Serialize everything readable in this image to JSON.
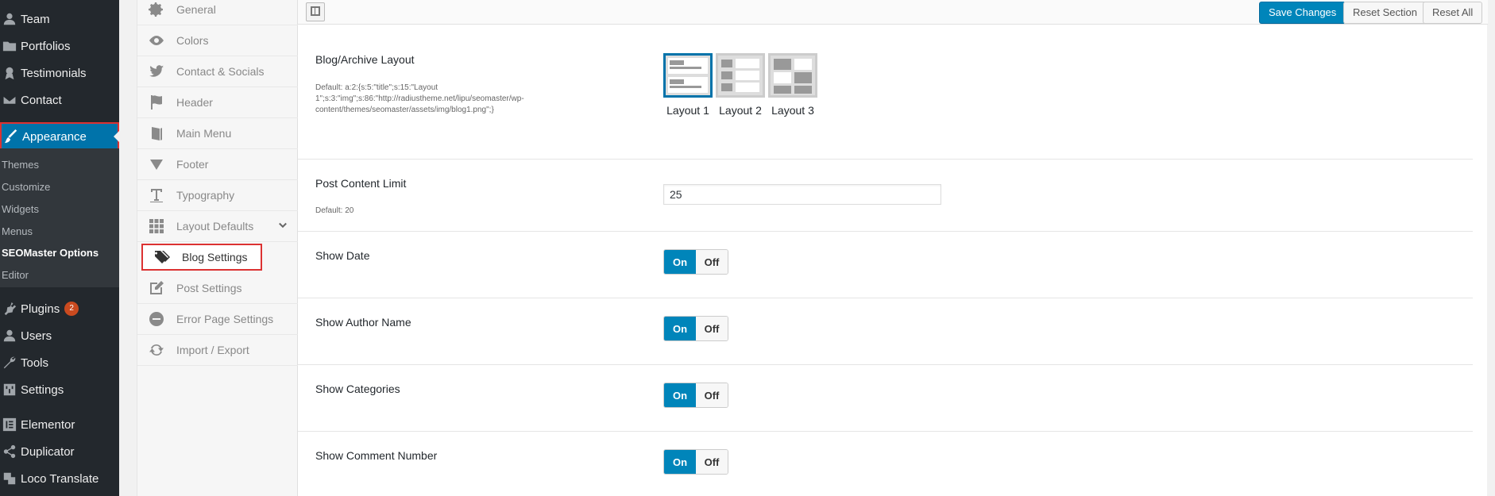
{
  "admin_menu": {
    "items": [
      {
        "label": "Team",
        "icon": "user-icon"
      },
      {
        "label": "Portfolios",
        "icon": "folder-icon"
      },
      {
        "label": "Testimonials",
        "icon": "award-icon"
      },
      {
        "label": "Contact",
        "icon": "mail-icon"
      },
      {
        "label": "Appearance",
        "icon": "paintbrush-icon"
      }
    ],
    "submenu": [
      "Themes",
      "Customize",
      "Widgets",
      "Menus",
      "SEOMaster Options",
      "Editor"
    ],
    "lower_items": [
      {
        "label": "Plugins",
        "icon": "plugin-icon",
        "badge": "2"
      },
      {
        "label": "Users",
        "icon": "user-icon"
      },
      {
        "label": "Tools",
        "icon": "wrench-icon"
      },
      {
        "label": "Settings",
        "icon": "settings-icon"
      },
      {
        "label": "Elementor",
        "icon": "elementor-icon"
      },
      {
        "label": "Duplicator",
        "icon": "share-icon"
      },
      {
        "label": "Loco Translate",
        "icon": "translate-icon"
      }
    ]
  },
  "options_nav": [
    {
      "label": "General",
      "icon": "gear-icon"
    },
    {
      "label": "Colors",
      "icon": "eye-icon"
    },
    {
      "label": "Contact & Socials",
      "icon": "twitter-icon"
    },
    {
      "label": "Header",
      "icon": "flag-icon"
    },
    {
      "label": "Main Menu",
      "icon": "book-icon"
    },
    {
      "label": "Footer",
      "icon": "triangle-down-icon"
    },
    {
      "label": "Typography",
      "icon": "text-icon"
    },
    {
      "label": "Layout Defaults",
      "icon": "grid-icon"
    },
    {
      "label": "Blog Settings",
      "icon": "tags-icon"
    },
    {
      "label": "Post Settings",
      "icon": "edit-icon"
    },
    {
      "label": "Error Page Settings",
      "icon": "minus-circle-icon"
    },
    {
      "label": "Import / Export",
      "icon": "refresh-icon"
    }
  ],
  "toolbar": {
    "save": "Save Changes",
    "reset_section": "Reset Section",
    "reset_all": "Reset All"
  },
  "blog_layout": {
    "title": "Blog/Archive Layout",
    "default": "Default: a:2:{s:5:\"title\";s:15:\"Layout",
    "default_bold": "Layout",
    "default_line2": "1\";s:3:\"img\";s:86:\"http://radiustheme.net/lipu/seomaster/wp-",
    "default_line3": "content/themes/seomaster/assets/img/blog1.png\";}",
    "options": [
      "Layout 1",
      "Layout 2",
      "Layout 3"
    ],
    "selected": 0
  },
  "post_limit": {
    "title": "Post Content Limit",
    "default": "Default: 20",
    "value": "25"
  },
  "toggles": [
    {
      "title": "Show Date",
      "on": "On",
      "off": "Off"
    },
    {
      "title": "Show Author Name",
      "on": "On",
      "off": "Off"
    },
    {
      "title": "Show Categories",
      "on": "On",
      "off": "Off"
    },
    {
      "title": "Show Comment Number",
      "on": "On",
      "off": "Off"
    }
  ],
  "colors": {
    "admin_bg": "#23282d",
    "accent": "#0073aa",
    "highlight": "#dc3232"
  }
}
